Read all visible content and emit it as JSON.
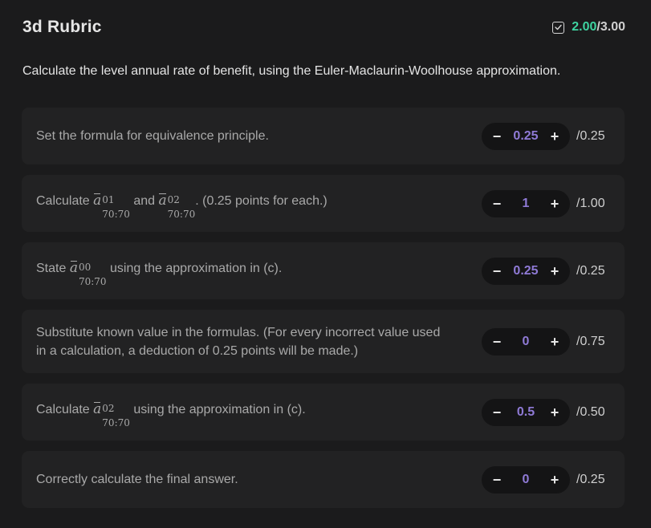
{
  "header": {
    "title": "3d Rubric",
    "score_earned": "2.00",
    "score_total": "/3.00",
    "check_icon": "checkbox-checked-icon"
  },
  "prompt": "Calculate the level annual rate of benefit, using the Euler-Maclaurin-Woolhouse approximation.",
  "colors": {
    "earned": "#3ed3a0",
    "stepper_value": "#8f7ad6",
    "card_bg": "#222223",
    "page_bg": "#1b1b1c"
  },
  "criteria": [
    {
      "text": "Set the formula for equivalence principle.",
      "value": "0.25",
      "max": "/0.25"
    },
    {
      "text_before": "Calculate ",
      "math1": {
        "sup": "01",
        "sub": "70:70"
      },
      "text_mid": " and ",
      "math2": {
        "sup": "02",
        "sub": "70:70"
      },
      "text_after": ". (0.25 points for each.)",
      "value": "1",
      "max": "/1.00"
    },
    {
      "text_before": "State ",
      "math1": {
        "sup": "00",
        "sub": "70:70"
      },
      "text_after": " using the approximation in (c).",
      "value": "0.25",
      "max": "/0.25"
    },
    {
      "text": "Substitute known value in the formulas. (For every incorrect value used in a calculation, a deduction of 0.25 points will be made.)",
      "value": "0",
      "max": "/0.75"
    },
    {
      "text_before": "Calculate ",
      "math1": {
        "sup": "02",
        "sub": "70:70"
      },
      "text_after": " using the approximation in (c).",
      "value": "0.5",
      "max": "/0.50"
    },
    {
      "text": "Correctly calculate the final answer.",
      "value": "0",
      "max": "/0.25"
    }
  ],
  "stepper": {
    "minus": "−",
    "plus": "+"
  }
}
